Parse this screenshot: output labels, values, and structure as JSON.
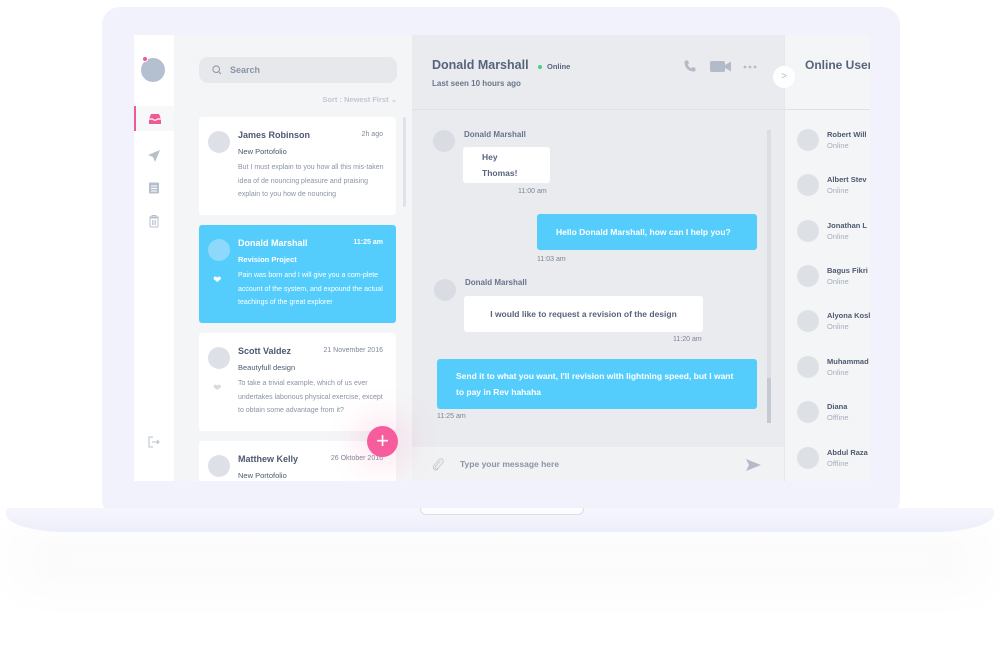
{
  "sidebar": {
    "items": [
      {
        "name": "inbox",
        "icon": "inbox-icon",
        "active": true
      },
      {
        "name": "sent",
        "icon": "paper-plane-icon",
        "active": false
      },
      {
        "name": "drafts",
        "icon": "document-icon",
        "active": false
      },
      {
        "name": "trash",
        "icon": "trash-icon",
        "active": false
      }
    ],
    "logout_icon": "logout-icon",
    "accent": "#f05a92"
  },
  "message_list": {
    "search_placeholder": "Search",
    "sort_label": "Sort : Newest First",
    "messages": [
      {
        "name": "James Robinson",
        "time": "2h ago",
        "subject": "New Portofolio",
        "preview": "But I must explain to you how all this mis-taken idea of de nouncing pleasure and praising explain to you how de nouncing",
        "selected": false,
        "liked": false
      },
      {
        "name": "Donald Marshall",
        "time": "11:25 am",
        "subject": "Revision Project",
        "preview": "Pain was born and I will give you a com-plete account of the system, and expound the actual teachings of the great explorer",
        "selected": true,
        "liked": true
      },
      {
        "name": "Scott Valdez",
        "time": "21 November 2016",
        "subject": "Beautyfull design",
        "preview": "To take a trivial example, which of us ever undertakes laborious physical exercise, except to obtain some advantage from it?",
        "selected": false,
        "liked": false
      },
      {
        "name": "Matthew Kelly",
        "time": "26 Oktober 2016",
        "subject": "New Portofolio",
        "preview": "",
        "selected": false,
        "liked": false
      }
    ],
    "compose_label": "+"
  },
  "chat": {
    "contact_name": "Donald Marshall",
    "status": "Online",
    "last_seen": "Last seen 10 hours ago",
    "messages": [
      {
        "direction": "in",
        "sender": "Donald Marshall",
        "text": "Hey Thomas!",
        "time": "11:00 am"
      },
      {
        "direction": "out",
        "sender": "",
        "text": "Hello Donald Marshall, how can I help you?",
        "time": "11:03 am"
      },
      {
        "direction": "in",
        "sender": "Donald Marshall",
        "text": "I would like to request a revision of the design",
        "time": "11:20 am"
      },
      {
        "direction": "out",
        "sender": "",
        "text": "Send it to what you want, I'll revision with lightning speed, but I want to pay in Rev hahaha",
        "time": "11:25 am"
      }
    ],
    "composer_placeholder": "Type your message here",
    "accent": "#55cdfc"
  },
  "online_users": {
    "title": "Online Users",
    "collapse_label": ">",
    "users": [
      {
        "name": "Robert Will",
        "status": "Online"
      },
      {
        "name": "Albert Stev",
        "status": "Online"
      },
      {
        "name": "Jonathan L",
        "status": "Online"
      },
      {
        "name": "Bagus Fikri",
        "status": "Online"
      },
      {
        "name": "Alyona Kosl",
        "status": "Online"
      },
      {
        "name": "Muhammad",
        "status": "Online"
      },
      {
        "name": "Diana",
        "status": "Offline"
      },
      {
        "name": "Abdul Raza",
        "status": "Offline"
      }
    ]
  }
}
